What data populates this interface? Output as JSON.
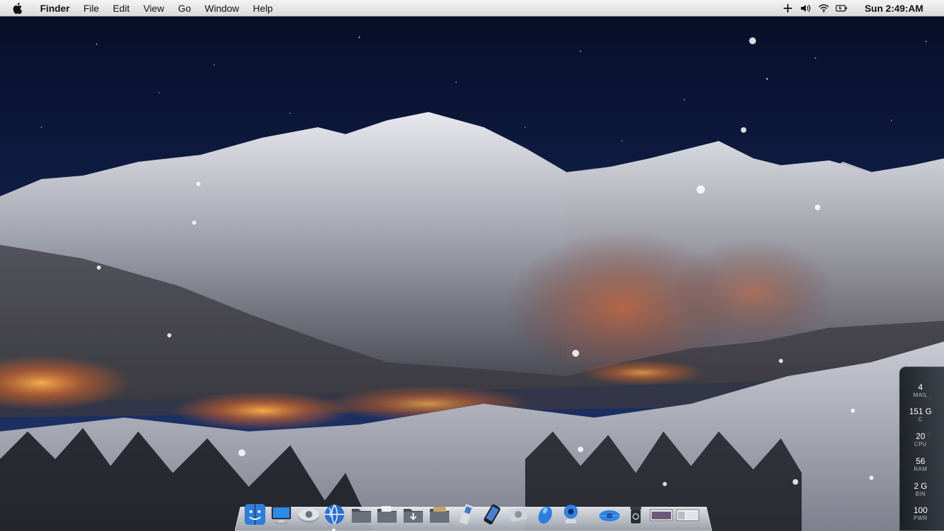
{
  "menubar": {
    "app_name": "Finder",
    "menus": [
      "File",
      "Edit",
      "View",
      "Go",
      "Window",
      "Help"
    ],
    "status_icons": [
      "plus-icon",
      "volume-icon",
      "wifi-icon",
      "battery-icon"
    ],
    "clock": "Sun 2:49:AM"
  },
  "dock": {
    "items": [
      {
        "name": "finder-icon"
      },
      {
        "name": "computer-icon"
      },
      {
        "name": "hard-disk-icon"
      },
      {
        "name": "globe-icon"
      },
      {
        "name": "folder-icon"
      },
      {
        "name": "documents-folder-icon"
      },
      {
        "name": "downloads-folder-icon"
      },
      {
        "name": "pictures-folder-icon"
      },
      {
        "name": "phone-icon"
      },
      {
        "name": "mobile-device-icon"
      },
      {
        "name": "disk-drive-icon"
      },
      {
        "name": "mouse-icon"
      },
      {
        "name": "webcam-icon"
      },
      {
        "name": "settings-gear-icon"
      },
      {
        "name": "trash-icon"
      },
      {
        "name": "window-thumbnail-icon"
      },
      {
        "name": "window-thumbnail-icon"
      }
    ]
  },
  "sysmon": {
    "stats": [
      {
        "value": "4",
        "label": "MAIL"
      },
      {
        "value": "151 G",
        "label": "C"
      },
      {
        "value": "20",
        "label": "CPU"
      },
      {
        "value": "56",
        "label": "RAM"
      },
      {
        "value": "2 G",
        "label": "BIN"
      },
      {
        "value": "100",
        "label": "PWR"
      }
    ]
  },
  "colors": {
    "sky_top": "#0a1433",
    "sky_horizon": "#1e3363",
    "snow": "#c9ccd6",
    "city_glow": "#ff8a2a",
    "menubar": "#e6e6e6"
  }
}
